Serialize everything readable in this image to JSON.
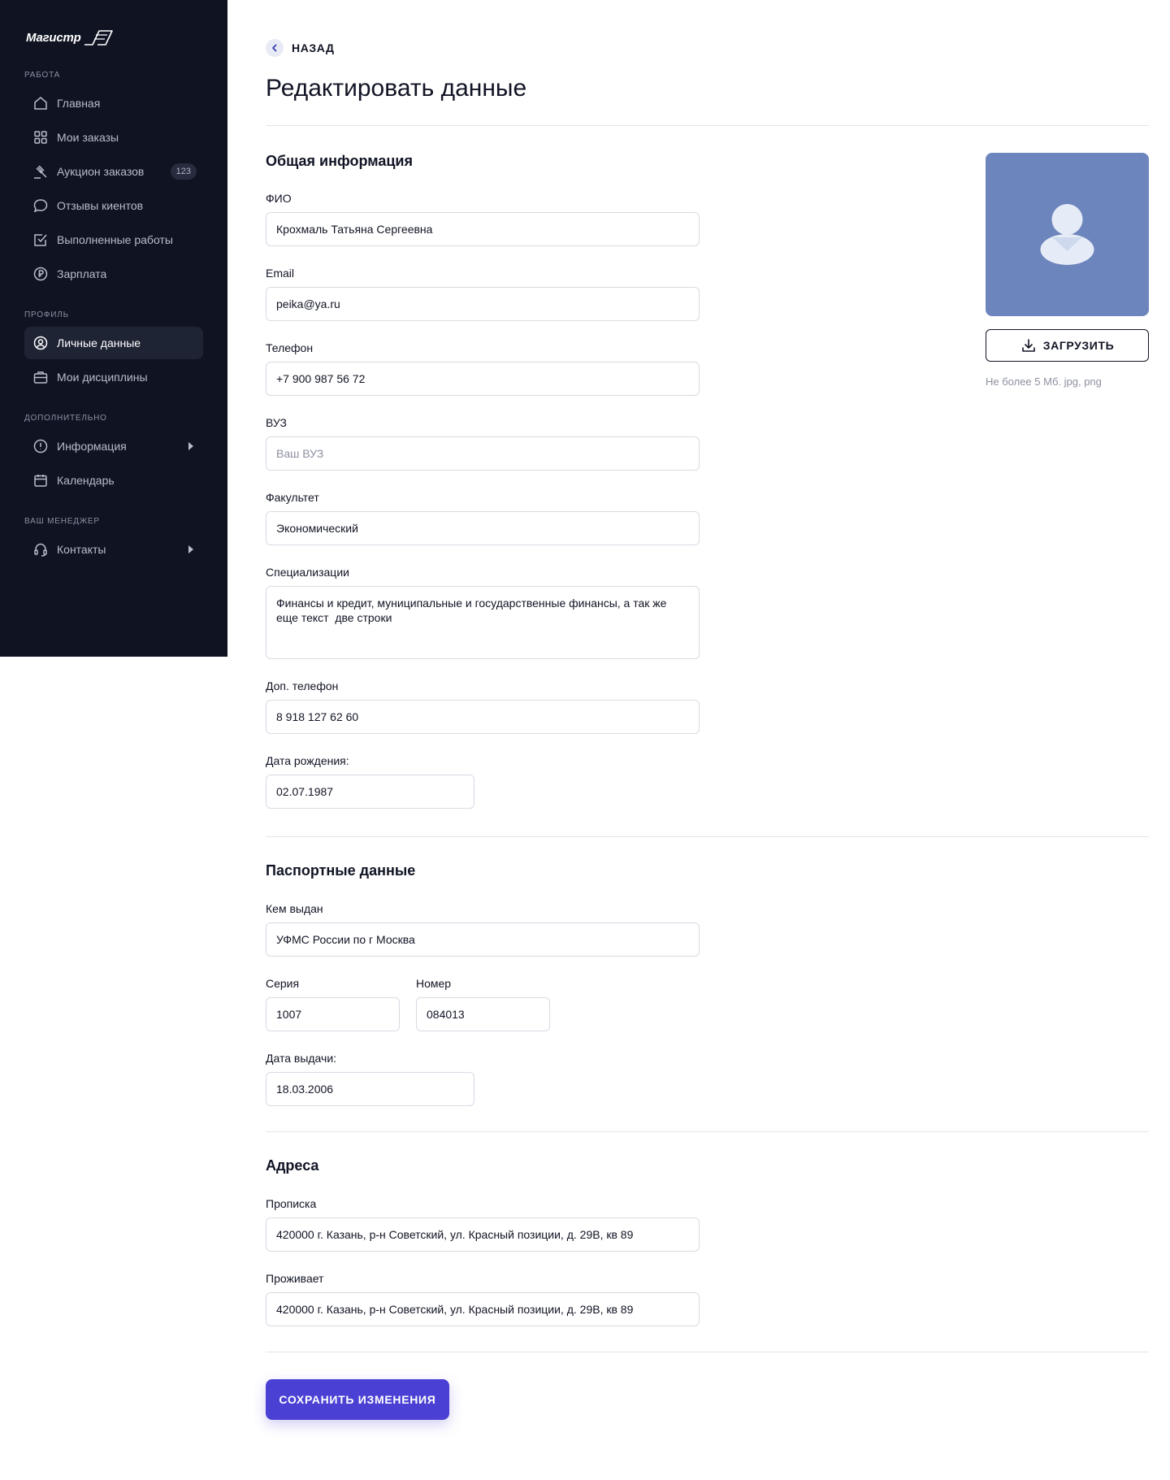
{
  "sidebar": {
    "logo_text": "Магистр",
    "sections": {
      "work": "РАБОТА",
      "profile": "ПРОФИЛЬ",
      "extra": "ДОПОЛНИТЕЛЬНО",
      "manager": "ВАШ МЕНЕДЖЕР"
    },
    "items": [
      {
        "label": "Главная",
        "icon": "home-icon"
      },
      {
        "label": "Мои заказы",
        "icon": "grid-icon"
      },
      {
        "label": "Аукцион заказов",
        "icon": "gavel-icon",
        "badge": "123"
      },
      {
        "label": "Отзывы киентов",
        "icon": "chat-bubble-icon"
      },
      {
        "label": "Выполненные работы",
        "icon": "checkbox-icon"
      },
      {
        "label": "Зарплата",
        "icon": "ruble-icon"
      },
      {
        "label": "Личные данные",
        "icon": "user-circle-icon",
        "active": true
      },
      {
        "label": "Мои дисциплины",
        "icon": "briefcase-icon"
      },
      {
        "label": "Информация",
        "icon": "alert-circle-icon"
      },
      {
        "label": "Календарь",
        "icon": "calendar-icon"
      },
      {
        "label": "Контакты",
        "icon": "headset-icon"
      }
    ]
  },
  "header": {
    "back_label": "НАЗАД",
    "title": "Редактировать данные"
  },
  "general": {
    "title": "Общая информация",
    "fio_label": "ФИО",
    "fio_value": "Крохмаль Татьяна Сергеевна",
    "email_label": "Email",
    "email_value": "peika@ya.ru",
    "phone_label": "Телефон",
    "phone_value": "+7 900 987 56 72",
    "vuz_label": "ВУЗ",
    "vuz_placeholder": "Ваш ВУЗ",
    "faculty_label": "Факультет",
    "faculty_value": "Экономический",
    "spec_label": "Специализации",
    "spec_value": "Финансы и кредит, муниципальные и государственные финансы, а так же еще текст  две строки",
    "extra_phone_label": "Доп. телефон",
    "extra_phone_value": "8 918 127 62 60",
    "birth_label": "Дата рождения:",
    "birth_value": "02.07.1987"
  },
  "photo": {
    "upload_label": "ЗАГРУЗИТЬ",
    "hint": "Не более 5 Мб. jpg, png"
  },
  "passport": {
    "title": "Паспортные данные",
    "issued_by_label": "Кем выдан",
    "issued_by_value": "УФМС России по г Москва",
    "series_label": "Серия",
    "series_value": "1007",
    "number_label": "Номер",
    "number_value": "084013",
    "issue_date_label": "Дата выдачи:",
    "issue_date_value": "18.03.2006"
  },
  "addresses": {
    "title": "Адреса",
    "registration_label": "Прописка",
    "registration_value": "420000 г. Казань, р-н Советский, ул. Красный позиции, д. 29В, кв 89",
    "residence_label": "Проживает",
    "residence_value": "420000 г. Казань, р-н Советский, ул. Красный позиции, д. 29В, кв 89"
  },
  "actions": {
    "save_label": "СОХРАНИТЬ ИЗМЕНЕНИЯ"
  },
  "colors": {
    "sidebar_bg": "#0f1322",
    "accent": "#4a40d4",
    "avatar_bg": "#6d85bd"
  }
}
